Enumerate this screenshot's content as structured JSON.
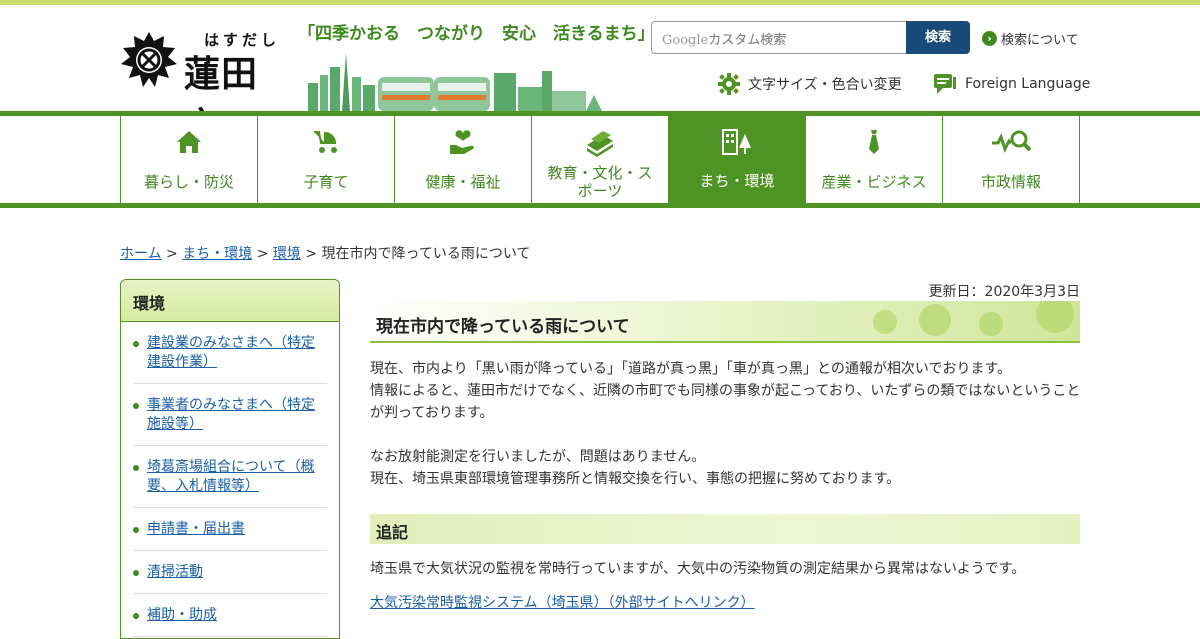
{
  "header": {
    "logo_kana": "はすだし",
    "logo_name": "蓮田市",
    "slogan": "「四季かおる　つながり　安心　活きるまち」",
    "search": {
      "google_label": "Google",
      "placeholder": "カスタム検索",
      "button_label": "検索",
      "about_label": "検索について"
    },
    "utilities": {
      "text_size_color": "文字サイズ・色合い変更",
      "foreign_language": "Foreign Language"
    }
  },
  "nav": {
    "items": [
      {
        "label": "暮らし・防災",
        "icon": "house-icon"
      },
      {
        "label": "子育て",
        "icon": "stroller-icon"
      },
      {
        "label": "健康・福祉",
        "icon": "heart-hand-icon"
      },
      {
        "label": "教育・文化・スポーツ",
        "icon": "books-icon"
      },
      {
        "label": "まち・環境",
        "icon": "buildings-icon",
        "active": true
      },
      {
        "label": "産業・ビジネス",
        "icon": "necktie-icon"
      },
      {
        "label": "市政情報",
        "icon": "search-chart-icon"
      }
    ]
  },
  "breadcrumb": {
    "items": [
      "ホーム",
      "まち・環境",
      "環境"
    ],
    "separator": ">",
    "current": "現在市内で降っている雨について"
  },
  "sidebar": {
    "title": "環境",
    "items": [
      "建設業のみなさまへ（特定建設作業）",
      "事業者のみなさまへ（特定施設等）",
      "埼葛斎場組合について（概要、入札情報等）",
      "申請書・届出書",
      "清掃活動",
      "補助・助成"
    ]
  },
  "main": {
    "updated": "更新日：2020年3月3日",
    "title": "現在市内で降っている雨について",
    "paragraph1": [
      "現在、市内より「黒い雨が降っている」「道路が真っ黒」「車が真っ黒」との通報が相次いでおります。",
      "情報によると、蓮田市だけでなく、近隣の市町でも同様の事象が起こっており、いたずらの類ではないということが判っております。"
    ],
    "paragraph2": [
      "なお放射能測定を行いましたが、問題はありません。",
      "現在、埼玉県東部環境管理事務所と情報交換を行い、事態の把握に努めております。"
    ],
    "addendum_heading": "追記",
    "addendum_text": "埼玉県で大気状況の監視を常時行っていますが、大気中の汚染物質の測定結果から異常はないようです。",
    "external_link": "大気汚染常時監視システム（埼玉県）（外部サイトへリンク）"
  },
  "colors": {
    "brand_green": "#4d9425",
    "light_green": "#c9e06e",
    "search_button": "#1a4a7a",
    "link": "#1a5fa8"
  }
}
